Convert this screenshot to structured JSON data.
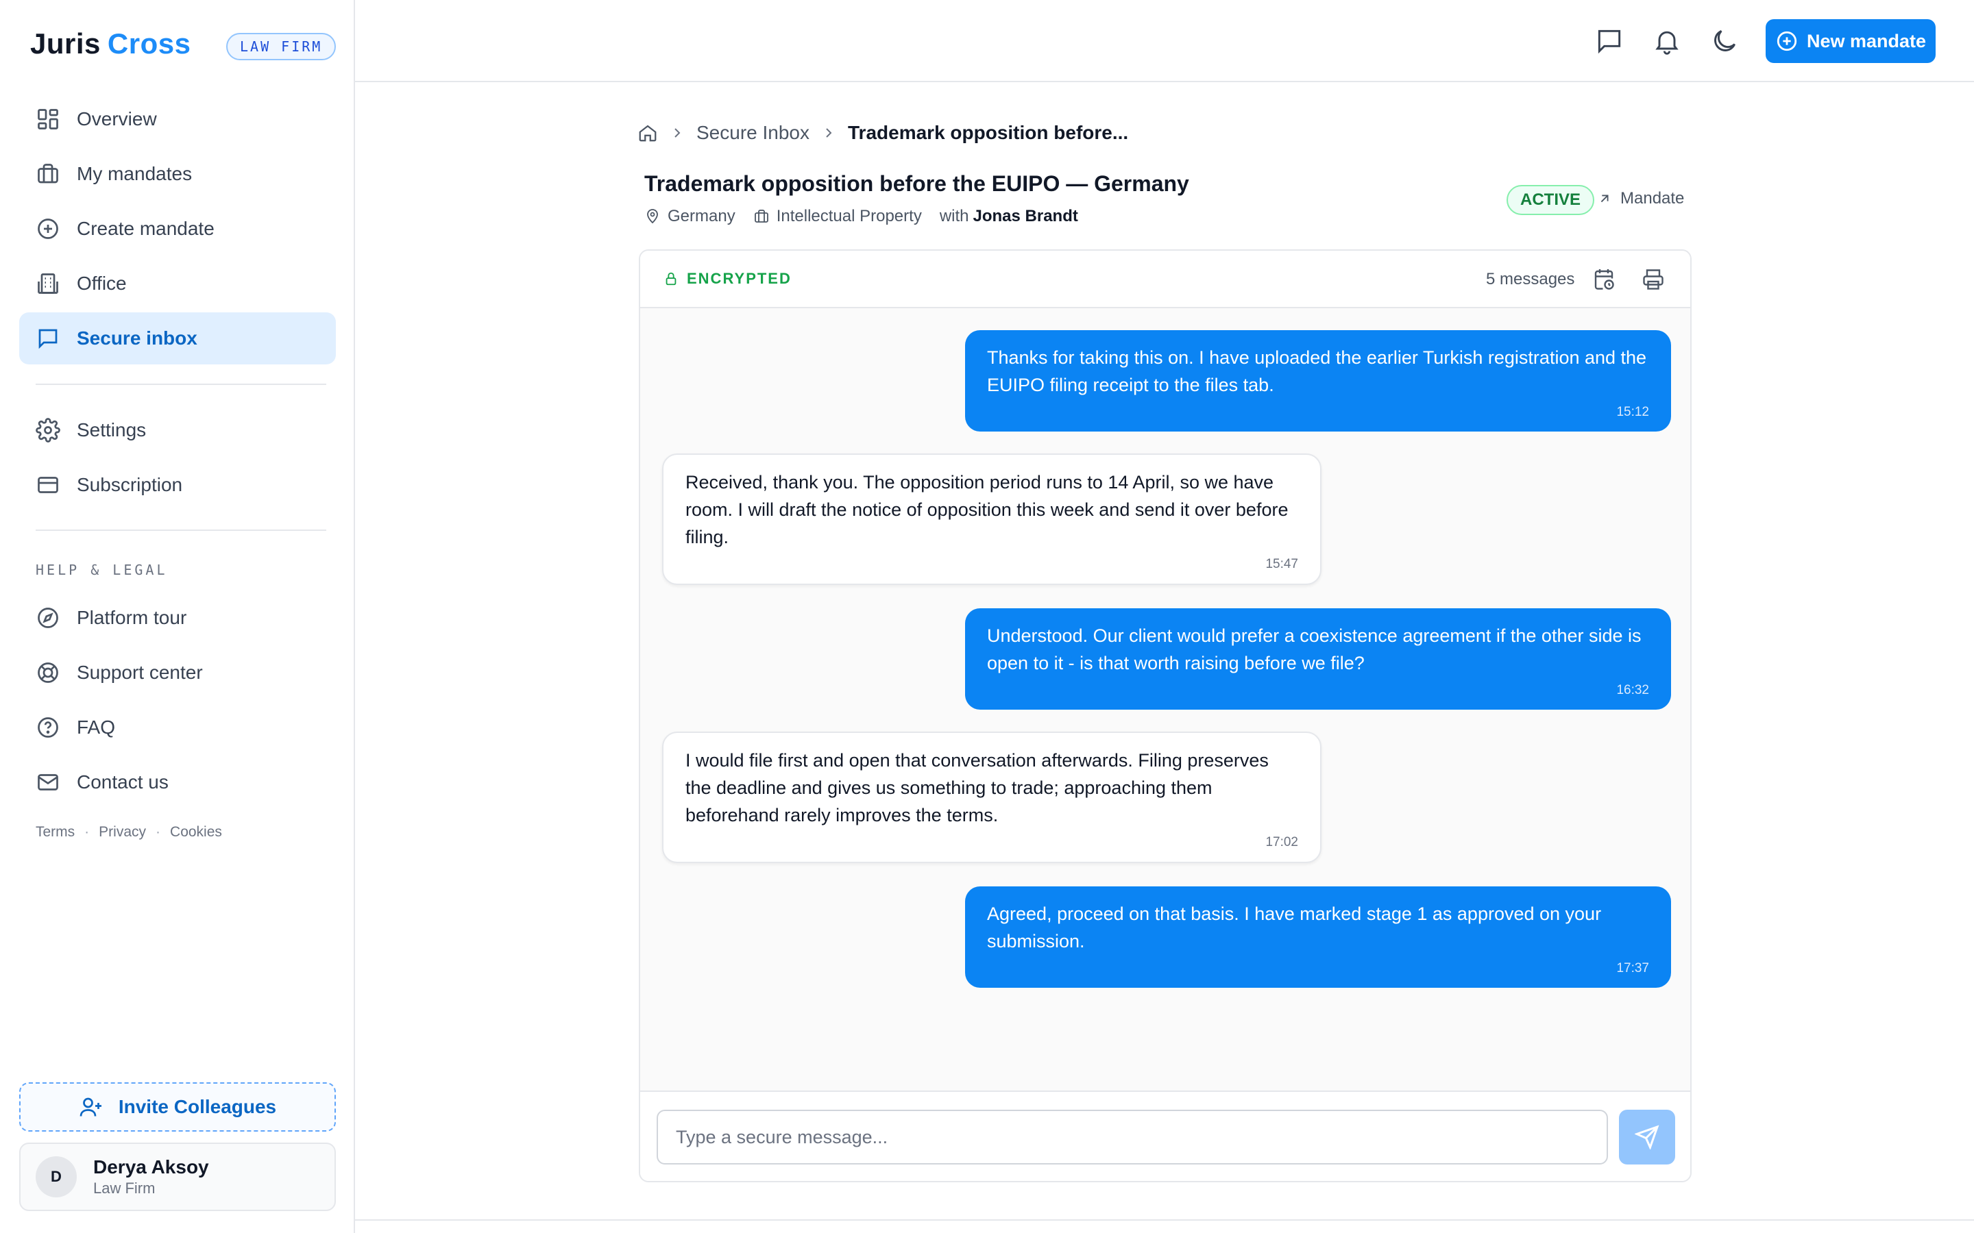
{
  "brand": {
    "name_part1": "Juris",
    "name_part2": "Cross",
    "badge": "LAW FIRM"
  },
  "sidebar": {
    "items": [
      {
        "label": "Overview",
        "icon": "grid-icon"
      },
      {
        "label": "My mandates",
        "icon": "briefcase-icon"
      },
      {
        "label": "Create mandate",
        "icon": "plus-circle-icon"
      },
      {
        "label": "Office",
        "icon": "building-icon"
      },
      {
        "label": "Secure inbox",
        "icon": "chat-icon",
        "active": true
      }
    ],
    "settings_items": [
      {
        "label": "Settings",
        "icon": "gear-icon"
      },
      {
        "label": "Subscription",
        "icon": "credit-card-icon"
      }
    ],
    "help_section_label": "HELP & LEGAL",
    "help_items": [
      {
        "label": "Platform tour",
        "icon": "compass-icon"
      },
      {
        "label": "Support center",
        "icon": "lifebuoy-icon"
      },
      {
        "label": "FAQ",
        "icon": "question-circle-icon"
      },
      {
        "label": "Contact us",
        "icon": "mail-icon"
      }
    ],
    "legal_links": [
      "Terms",
      "Privacy",
      "Cookies"
    ],
    "invite_label": "Invite Colleagues",
    "user": {
      "initial": "D",
      "name": "Derya Aksoy",
      "role": "Law Firm"
    }
  },
  "header": {
    "new_button_label": "New mandate"
  },
  "breadcrumb": {
    "section": "Secure Inbox",
    "current": "Trademark opposition before..."
  },
  "thread": {
    "title": "Trademark opposition before the EUIPO — Germany",
    "country": "Germany",
    "practice_area": "Intellectual Property",
    "with_label": "with",
    "counterpart": "Jonas Brandt",
    "status": "ACTIVE",
    "mandate_link": "Mandate"
  },
  "chat": {
    "encrypted_label": "ENCRYPTED",
    "message_count": "5 messages",
    "messages": [
      {
        "direction": "out",
        "text": "Thanks for taking this on. I have uploaded the earlier Turkish registration and the EUIPO filing receipt to the files tab.",
        "time": "15:12"
      },
      {
        "direction": "in",
        "text": "Received, thank you. The opposition period runs to 14 April, so we have room. I will draft the notice of opposition this week and send it over before filing.",
        "time": "15:47"
      },
      {
        "direction": "out",
        "text": "Understood. Our client would prefer a coexistence agreement if the other side is open to it - is that worth raising before we file?",
        "time": "16:32"
      },
      {
        "direction": "in",
        "text": "I would file first and open that conversation afterwards. Filing preserves the deadline and gives us something to trade; approaching them beforehand rarely improves the terms.",
        "time": "17:02"
      },
      {
        "direction": "out",
        "text": "Agreed, proceed on that basis. I have marked stage 1 as approved on your submission.",
        "time": "17:37"
      }
    ],
    "composer_placeholder": "Type a secure message..."
  },
  "colors": {
    "accent": "#0b84f3",
    "active_nav_bg": "#e0efff",
    "status_green": "#15803d"
  }
}
